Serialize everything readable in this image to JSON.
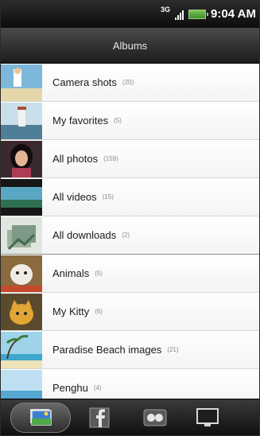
{
  "status": {
    "network": "3G",
    "time": "9:04 AM"
  },
  "header": {
    "title": "Albums"
  },
  "albums": [
    {
      "name": "Camera shots",
      "count": "(20)"
    },
    {
      "name": "My favorites",
      "count": "(5)"
    },
    {
      "name": "All photos",
      "count": "(159)"
    },
    {
      "name": "All videos",
      "count": "(15)"
    },
    {
      "name": "All downloads",
      "count": "(2)"
    },
    {
      "name": "Animals",
      "count": "(5)"
    },
    {
      "name": "My Kitty",
      "count": "(6)"
    },
    {
      "name": "Paradise Beach images",
      "count": "(21)"
    },
    {
      "name": "Penghu",
      "count": "(4)"
    }
  ],
  "dock": {
    "active_tab": "albums",
    "tabs": [
      "albums-tab-icon",
      "facebook-icon",
      "flickr-icon",
      "tv-display-icon"
    ]
  },
  "colors": {
    "titlebar": "#2b2b2b",
    "list_bg": "#ffffff",
    "battery": "#6ab84b"
  }
}
